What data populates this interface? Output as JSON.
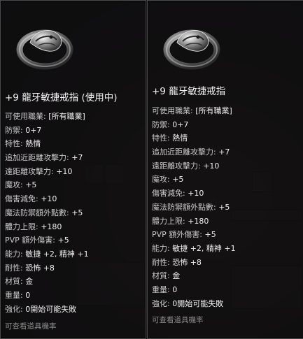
{
  "colors": {
    "panel_bg": "#0e0e10",
    "panel_border": "#4b4b4b",
    "text": "#e7e7e7",
    "label": "#c9c9c9",
    "footer": "#8d8d8d"
  },
  "item_icon": "silver-dragon-ring-icon",
  "left": {
    "title": "+9 龍牙敏捷戒指 (使用中)",
    "stats": [
      {
        "k": "可使用職業: ",
        "v": "[所有職業]"
      },
      {
        "k": "防禦: ",
        "v": "0+7"
      },
      {
        "k": "特性: ",
        "v": "熱情"
      },
      {
        "k": "追加近距離攻擊力: ",
        "v": "+7"
      },
      {
        "k": "遠距離攻擊力: ",
        "v": "+10"
      },
      {
        "k": "魔攻: ",
        "v": "+5"
      },
      {
        "k": "傷害減免: ",
        "v": "+10"
      },
      {
        "k": "魔法防禦額外點數: ",
        "v": "+5"
      },
      {
        "k": "體力上限: ",
        "v": "+180"
      },
      {
        "k": "PVP 額外傷害: ",
        "v": "+5"
      },
      {
        "k": "能力: ",
        "v": "敏捷 +2, 精神 +1"
      },
      {
        "k": "耐性: ",
        "v": "恐怖 +8"
      },
      {
        "k": "材質: ",
        "v": "金"
      },
      {
        "k": "重量: ",
        "v": "0"
      },
      {
        "k": "強化: ",
        "v": "0開始可能失敗"
      }
    ],
    "footer": "可查看道具機率"
  },
  "right": {
    "title": "+9 龍牙敏捷戒指",
    "stats": [
      {
        "k": "可使用職業: ",
        "v": "[所有職業]"
      },
      {
        "k": "防禦: ",
        "v": "0+7"
      },
      {
        "k": "特性: ",
        "v": "熱情"
      },
      {
        "k": "追加近距離攻擊力: ",
        "v": "+7"
      },
      {
        "k": "遠距離攻擊力: ",
        "v": "+10"
      },
      {
        "k": "魔攻: ",
        "v": "+5"
      },
      {
        "k": "傷害減免: ",
        "v": "+10"
      },
      {
        "k": "魔法防禦額外點數: ",
        "v": "+5"
      },
      {
        "k": "體力上限: ",
        "v": "+180"
      },
      {
        "k": "PVP 額外傷害: ",
        "v": "+5"
      },
      {
        "k": "能力: ",
        "v": "敏捷 +2, 精神 +1"
      },
      {
        "k": "耐性: ",
        "v": "恐怖 +8"
      },
      {
        "k": "材質: ",
        "v": "金"
      },
      {
        "k": "重量: ",
        "v": "0"
      },
      {
        "k": "強化: ",
        "v": "0開始可能失敗"
      }
    ],
    "footer": "可查看道具機率"
  }
}
